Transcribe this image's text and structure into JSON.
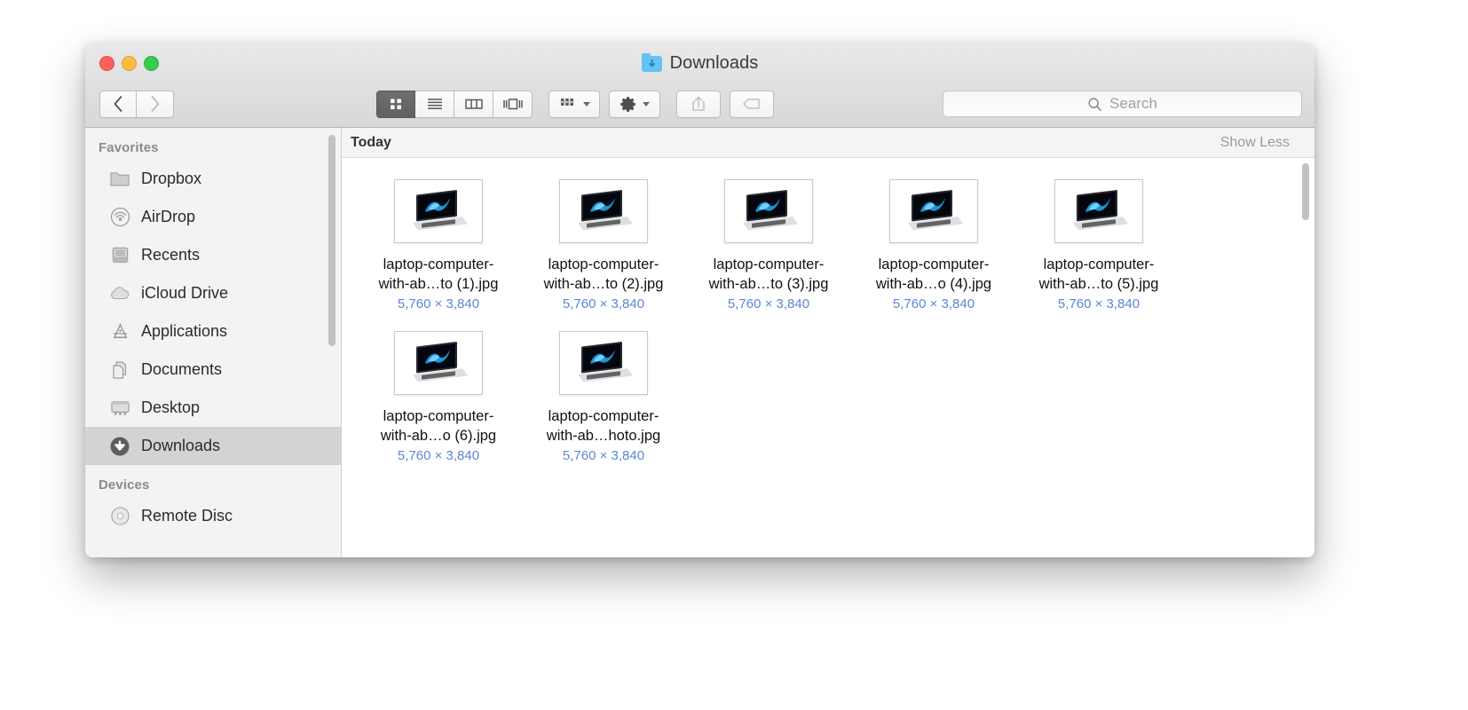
{
  "window": {
    "title": "Downloads",
    "title_icon": "downloads-folder-icon",
    "traffic_lights": {
      "close": "close-button",
      "minimize": "minimize-button",
      "maximize": "maximize-button"
    }
  },
  "toolbar": {
    "back_label": "‹",
    "forward_label": "›",
    "view_buttons": [
      {
        "name": "icon-view",
        "icon": "grid-icon",
        "active": true
      },
      {
        "name": "list-view",
        "icon": "list-icon",
        "active": false
      },
      {
        "name": "column-view",
        "icon": "columns-icon",
        "active": false
      },
      {
        "name": "gallery-view",
        "icon": "gallery-icon",
        "active": false
      }
    ],
    "arrange_icon": "arrange-grid-icon",
    "action_icon": "gear-icon",
    "share_icon": "share-icon",
    "tags_icon": "tag-icon"
  },
  "search": {
    "placeholder": "Search",
    "value": "",
    "icon": "search-icon"
  },
  "sidebar": {
    "sections": [
      {
        "header": "Favorites",
        "items": [
          {
            "label": "Dropbox",
            "icon": "folder-icon",
            "selected": false
          },
          {
            "label": "AirDrop",
            "icon": "airdrop-icon",
            "selected": false
          },
          {
            "label": "Recents",
            "icon": "recents-icon",
            "selected": false
          },
          {
            "label": "iCloud Drive",
            "icon": "cloud-icon",
            "selected": false
          },
          {
            "label": "Applications",
            "icon": "applications-icon",
            "selected": false
          },
          {
            "label": "Documents",
            "icon": "documents-icon",
            "selected": false
          },
          {
            "label": "Desktop",
            "icon": "desktop-icon",
            "selected": false
          },
          {
            "label": "Downloads",
            "icon": "downloads-icon",
            "selected": true
          }
        ]
      },
      {
        "header": "Devices",
        "items": [
          {
            "label": "Remote Disc",
            "icon": "disc-icon",
            "selected": false
          }
        ]
      }
    ]
  },
  "content": {
    "group_title": "Today",
    "group_action": "Show Less",
    "files": [
      {
        "name_line1": "laptop-computer-",
        "name_line2": "with-ab…to (1).jpg",
        "dimensions": "5,760 × 3,840",
        "thumbnail": "laptop-photo-thumbnail"
      },
      {
        "name_line1": "laptop-computer-",
        "name_line2": "with-ab…to (2).jpg",
        "dimensions": "5,760 × 3,840",
        "thumbnail": "laptop-photo-thumbnail"
      },
      {
        "name_line1": "laptop-computer-",
        "name_line2": "with-ab…to (3).jpg",
        "dimensions": "5,760 × 3,840",
        "thumbnail": "laptop-photo-thumbnail"
      },
      {
        "name_line1": "laptop-computer-",
        "name_line2": "with-ab…o (4).jpg",
        "dimensions": "5,760 × 3,840",
        "thumbnail": "laptop-photo-thumbnail"
      },
      {
        "name_line1": "laptop-computer-",
        "name_line2": "with-ab…to (5).jpg",
        "dimensions": "5,760 × 3,840",
        "thumbnail": "laptop-photo-thumbnail"
      },
      {
        "name_line1": "laptop-computer-",
        "name_line2": "with-ab…o (6).jpg",
        "dimensions": "5,760 × 3,840",
        "thumbnail": "laptop-photo-thumbnail"
      },
      {
        "name_line1": "laptop-computer-",
        "name_line2": "with-ab…hoto.jpg",
        "dimensions": "5,760 × 3,840",
        "thumbnail": "laptop-photo-thumbnail"
      }
    ]
  },
  "colors": {
    "selection": "#d3d3d3",
    "dimension_text": "#5b86d8",
    "active_view_button": "#686868",
    "folder_blue": "#63c3f2"
  }
}
